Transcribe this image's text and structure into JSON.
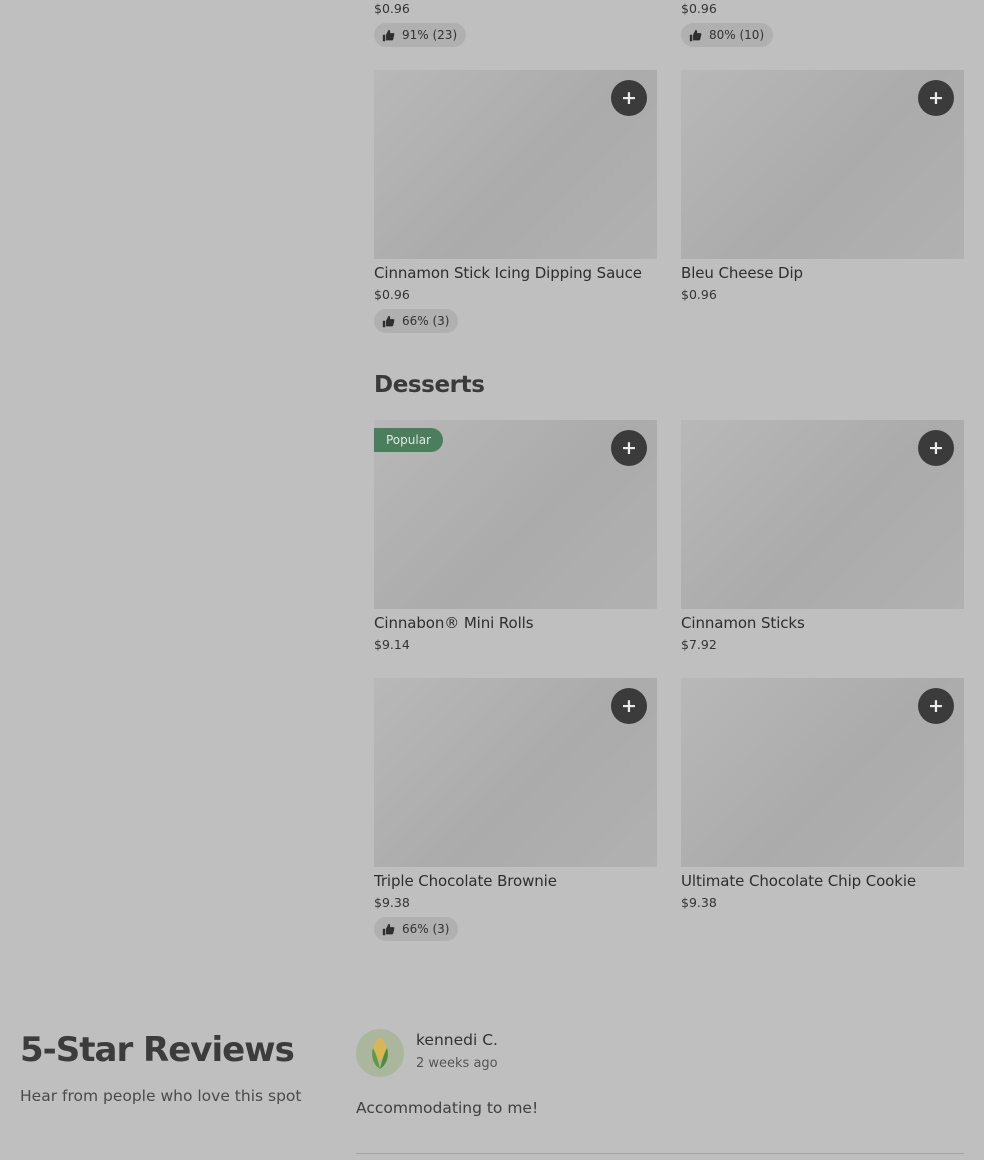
{
  "top_fragments": [
    {
      "price": "$0.96",
      "rating": "91% (23)"
    },
    {
      "price": "$0.96",
      "rating": "80% (10)"
    }
  ],
  "sauces": [
    {
      "name": "Cinnamon Stick Icing Dipping Sauce",
      "price": "$0.96",
      "rating": "66% (3)"
    },
    {
      "name": "Bleu Cheese Dip",
      "price": "$0.96"
    }
  ],
  "desserts_section": {
    "title": "Desserts",
    "items": [
      {
        "name": "Cinnabon® Mini Rolls",
        "price": "$9.14",
        "badge": "Popular"
      },
      {
        "name": "Cinnamon Sticks",
        "price": "$7.92"
      },
      {
        "name": "Triple Chocolate Brownie",
        "price": "$9.38",
        "rating": "66% (3)"
      },
      {
        "name": "Ultimate Chocolate Chip Cookie",
        "price": "$9.38"
      }
    ]
  },
  "add_button_label": "+",
  "reviews": {
    "title": "5-Star Reviews",
    "subtitle": "Hear from people who love this spot",
    "items": [
      {
        "author": "kennedi C.",
        "time": "2 weeks ago",
        "text": "Accommodating to me!"
      }
    ]
  },
  "icons": {
    "rating": "thumbs-up-icon",
    "add": "plus-icon",
    "avatar": "corn-icon"
  },
  "colors": {
    "popular_badge": "#4a7e5c",
    "add_button": "#3b3b3b"
  }
}
